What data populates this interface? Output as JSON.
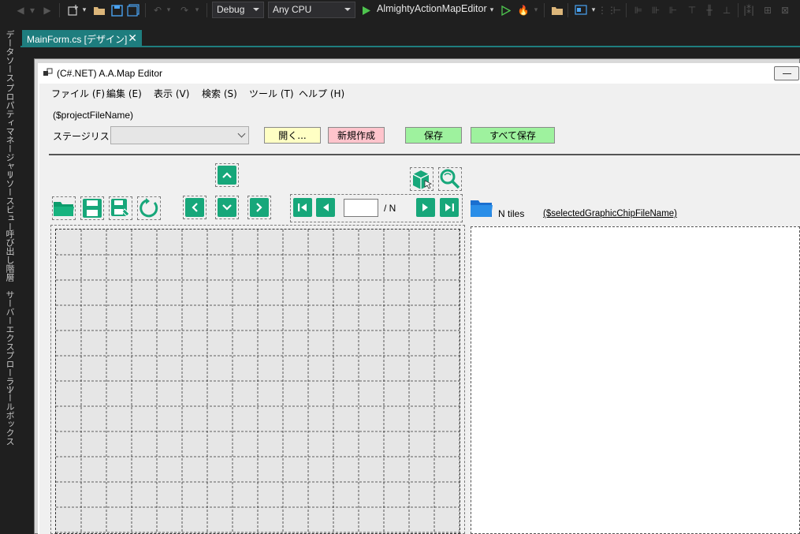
{
  "vs": {
    "config": "Debug",
    "platform": "Any CPU",
    "startup_project": "AlmightyActionMapEditor",
    "document_tab": "MainForm.cs [デザイン]",
    "side_tabs": [
      "データソース",
      "プロパティマネージャー",
      "リソースビュー",
      "呼び出し階層",
      "サーバーエクスプローラー",
      "ツールボックス"
    ]
  },
  "form": {
    "title": "(C#.NET) A.A.Map Editor",
    "menu": [
      "ファイル (F)",
      "編集 (E)",
      "表示 (V)",
      "検索 (S)",
      "ツール (T)",
      "ヘルプ (H)"
    ],
    "project_file_name": "($projectFileName)",
    "stage_list_label": "ステージリスト",
    "stage_list_value": "",
    "buttons": {
      "open": "開く...",
      "new": "新規作成",
      "save": "保存",
      "save_all": "すべて保存"
    },
    "page_value": "",
    "page_total": "/ N",
    "tiles_label": "N tiles",
    "selected_chip_file": "($selectedGraphicChipFileName)",
    "colors": {
      "open_bg": "#ffffc4",
      "new_bg": "#ffc4cc",
      "save_bg": "#9ef29e",
      "icon_green": "#17a77a",
      "folder_blue": "#2a8ee8",
      "accent_teal": "#1e7d7e"
    }
  }
}
